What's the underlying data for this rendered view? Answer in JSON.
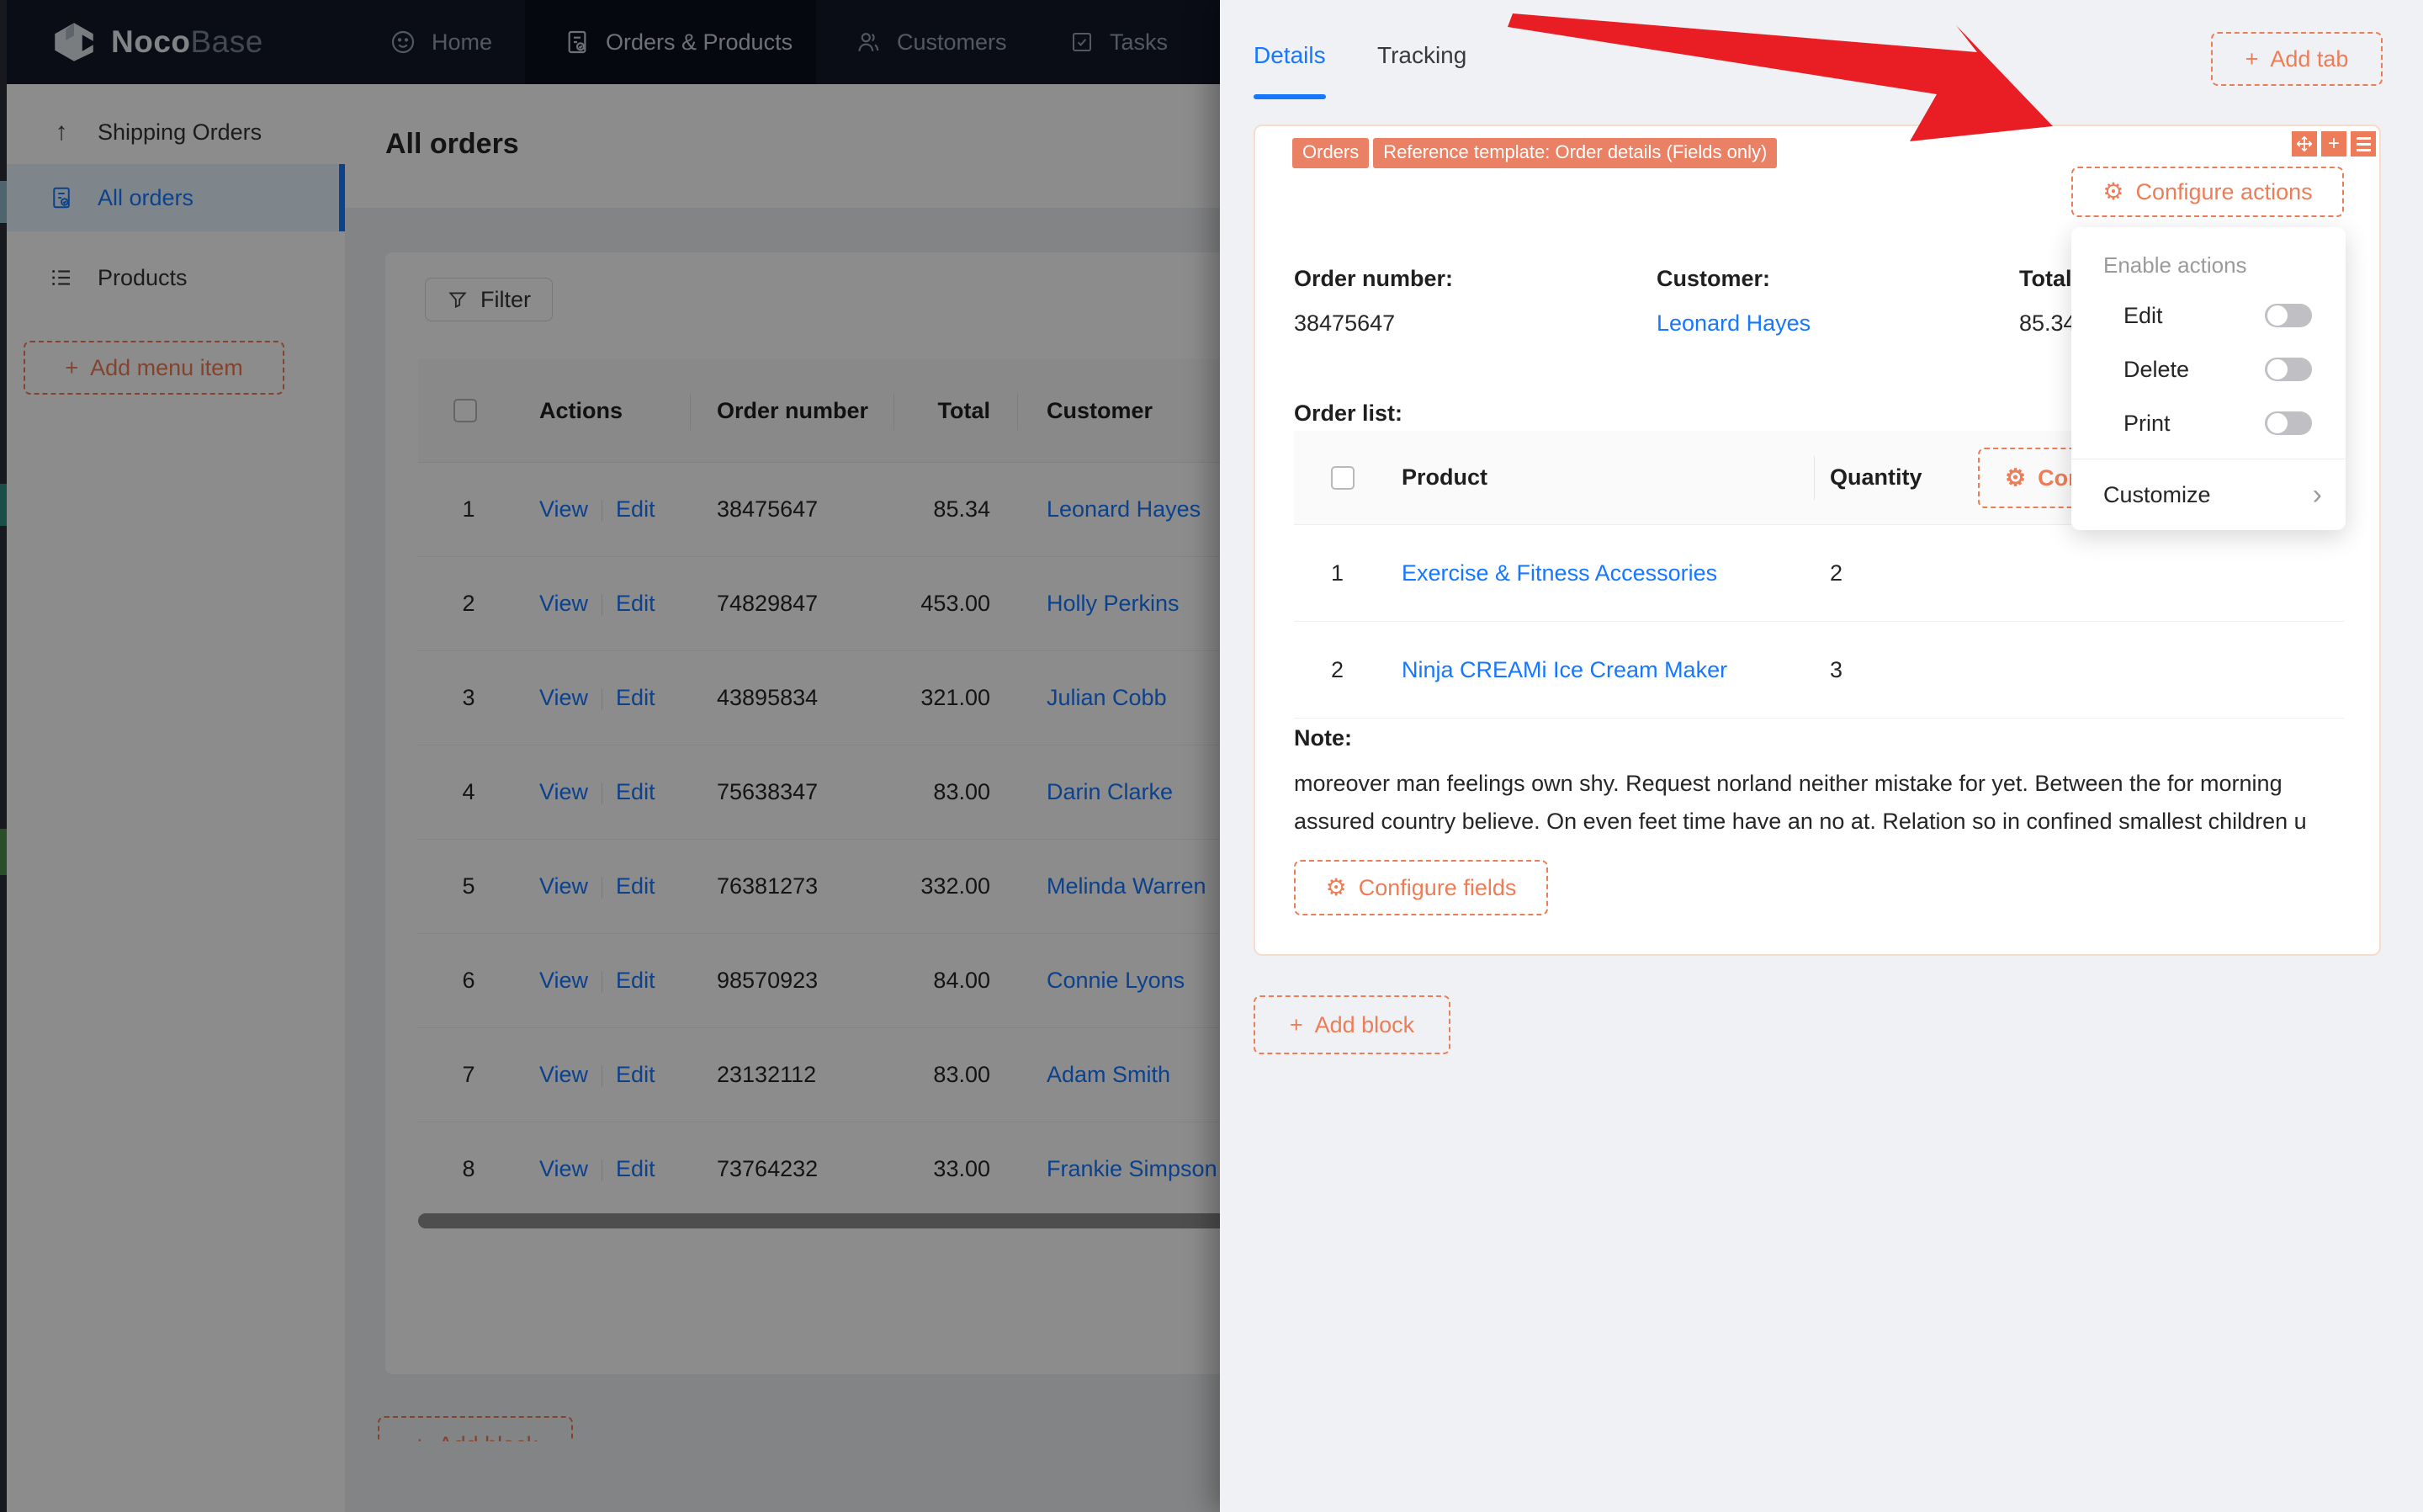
{
  "colors": {
    "accent_orange": "#ed7d57",
    "chip_orange": "#ea8064",
    "link_blue": "#1677ff",
    "arrow_red": "#e91e25",
    "navbar_bg": "#131928",
    "selected_item_bg": "#e6f4ff"
  },
  "icons": {
    "plus": "+",
    "gear": "⚙",
    "up_arrow": "↑",
    "chevron_right": "›"
  },
  "navbar": {
    "brand_bold": "Noco",
    "brand_light": "Base",
    "items": [
      {
        "label": "Home"
      },
      {
        "label": "Orders & Products"
      },
      {
        "label": "Customers"
      },
      {
        "label": "Tasks"
      }
    ]
  },
  "sidebar": {
    "items": [
      {
        "label": "Shipping Orders"
      },
      {
        "label": "All orders"
      },
      {
        "label": "Products"
      }
    ],
    "add_menu_item": "Add menu item"
  },
  "main": {
    "title": "All orders",
    "filter_label": "Filter",
    "table": {
      "headers": {
        "actions": "Actions",
        "order_number": "Order number",
        "total": "Total",
        "customer": "Customer"
      },
      "rows": [
        {
          "index": "1",
          "view": "View",
          "edit": "Edit",
          "order_number": "38475647",
          "total": "85.34",
          "customer": "Leonard Hayes"
        },
        {
          "index": "2",
          "view": "View",
          "edit": "Edit",
          "order_number": "74829847",
          "total": "453.00",
          "customer": "Holly Perkins"
        },
        {
          "index": "3",
          "view": "View",
          "edit": "Edit",
          "order_number": "43895834",
          "total": "321.00",
          "customer": "Julian Cobb"
        },
        {
          "index": "4",
          "view": "View",
          "edit": "Edit",
          "order_number": "75638347",
          "total": "83.00",
          "customer": "Darin Clarke"
        },
        {
          "index": "5",
          "view": "View",
          "edit": "Edit",
          "order_number": "76381273",
          "total": "332.00",
          "customer": "Melinda Warren"
        },
        {
          "index": "6",
          "view": "View",
          "edit": "Edit",
          "order_number": "98570923",
          "total": "84.00",
          "customer": "Connie Lyons"
        },
        {
          "index": "7",
          "view": "View",
          "edit": "Edit",
          "order_number": "23132112",
          "total": "83.00",
          "customer": "Adam Smith"
        },
        {
          "index": "8",
          "view": "View",
          "edit": "Edit",
          "order_number": "73764232",
          "total": "33.00",
          "customer": "Frankie Simpson"
        }
      ]
    },
    "add_block": "Add block"
  },
  "drawer": {
    "tabs": [
      {
        "label": "Details"
      },
      {
        "label": "Tracking"
      }
    ],
    "add_tab": "Add tab",
    "block": {
      "chips": [
        "Orders",
        "Reference template: Order details (Fields only)"
      ],
      "configure_actions": "Configure actions",
      "fields": [
        {
          "label": "Order number:",
          "value": "38475647"
        },
        {
          "label": "Customer:",
          "value": "Leonard Hayes"
        },
        {
          "label": "Total:",
          "value": "85.34"
        }
      ],
      "order_list_label": "Order list:",
      "order_table": {
        "product_header": "Product",
        "quantity_header": "Quantity",
        "configure_button": "Configure fields",
        "rows": [
          {
            "index": "1",
            "product": "Exercise & Fitness Accessories",
            "quantity": "2"
          },
          {
            "index": "2",
            "product": "Ninja CREAMi Ice Cream Maker",
            "quantity": "3"
          }
        ]
      },
      "note_label": "Note:",
      "note_lines": [
        "moreover man feelings own shy. Request norland neither mistake for yet. Between the for morning",
        "assured country believe. On even feet time have an no at. Relation so in confined smallest children u"
      ],
      "configure_fields": "Configure fields"
    },
    "menu": {
      "section_header": "Enable actions",
      "toggles": [
        {
          "label": "Edit",
          "enabled": false
        },
        {
          "label": "Delete",
          "enabled": false
        },
        {
          "label": "Print",
          "enabled": false
        }
      ],
      "customize": "Customize"
    },
    "add_block": "Add block"
  }
}
